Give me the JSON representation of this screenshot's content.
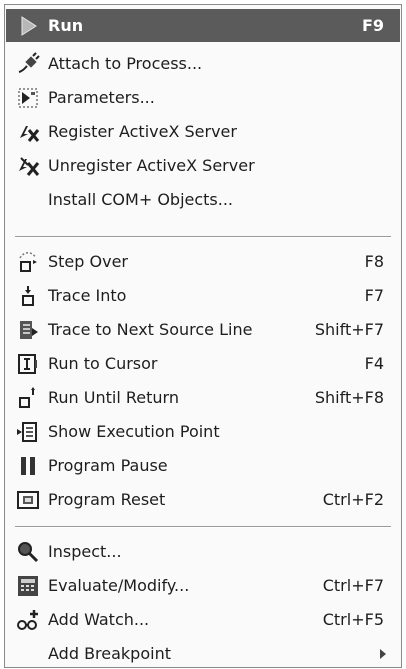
{
  "menu": {
    "items": [
      {
        "label": "Run",
        "shortcut": "F9",
        "icon": "run-arrow-icon"
      },
      {
        "label": "Attach to Process...",
        "shortcut": "",
        "icon": "attach-plug-icon"
      },
      {
        "label": "Parameters...",
        "shortcut": "",
        "icon": "parameters-icon"
      },
      {
        "label": "Register ActiveX Server",
        "shortcut": "",
        "icon": "register-activex-icon"
      },
      {
        "label": "Unregister ActiveX Server",
        "shortcut": "",
        "icon": "unregister-activex-icon"
      },
      {
        "label": "Install COM+ Objects...",
        "shortcut": "",
        "icon": ""
      },
      {
        "label": "Step Over",
        "shortcut": "F8",
        "icon": "step-over-icon"
      },
      {
        "label": "Trace Into",
        "shortcut": "F7",
        "icon": "trace-into-icon"
      },
      {
        "label": "Trace to Next Source Line",
        "shortcut": "Shift+F7",
        "icon": "trace-next-line-icon"
      },
      {
        "label": "Run to Cursor",
        "shortcut": "F4",
        "icon": "run-to-cursor-icon"
      },
      {
        "label": "Run Until Return",
        "shortcut": "Shift+F8",
        "icon": "run-until-return-icon"
      },
      {
        "label": "Show Execution Point",
        "shortcut": "",
        "icon": "execution-point-icon"
      },
      {
        "label": "Program Pause",
        "shortcut": "",
        "icon": "pause-icon"
      },
      {
        "label": "Program Reset",
        "shortcut": "Ctrl+F2",
        "icon": "reset-icon"
      },
      {
        "label": "Inspect...",
        "shortcut": "",
        "icon": "inspect-magnifier-icon"
      },
      {
        "label": "Evaluate/Modify...",
        "shortcut": "Ctrl+F7",
        "icon": "evaluate-calculator-icon"
      },
      {
        "label": "Add Watch...",
        "shortcut": "Ctrl+F5",
        "icon": "add-watch-glasses-icon"
      },
      {
        "label": "Add Breakpoint",
        "shortcut": "",
        "icon": "",
        "submenu": "submenu-arrow-icon"
      }
    ]
  },
  "colors": {
    "highlight": "#5b5b5b",
    "text": "#1e1e1e",
    "background": "#fafafa"
  }
}
